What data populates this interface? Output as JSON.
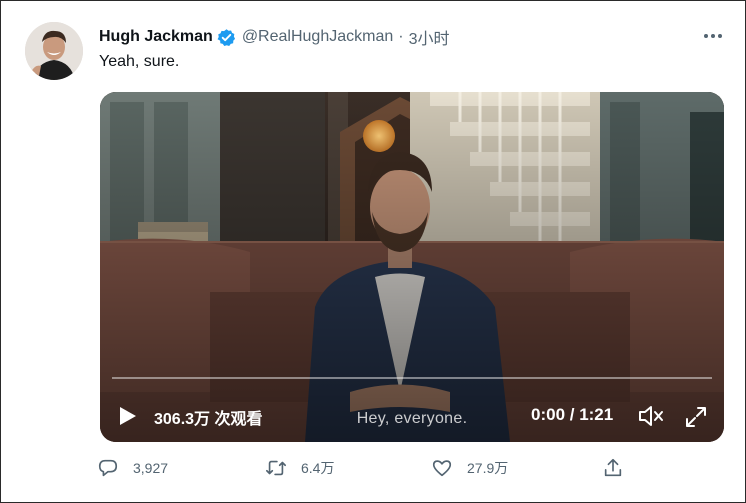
{
  "tweet": {
    "author_name": "Hugh Jackman",
    "handle": "@RealHughJackman",
    "separator": "·",
    "time": "3小时",
    "text": "Yeah, sure."
  },
  "video": {
    "views": "306.3万 次观看",
    "subtitle": "Hey, everyone.",
    "time": "0:00 / 1:21",
    "progress": 0.0
  },
  "actions": {
    "replies": "3,927",
    "retweets": "6.4万",
    "likes": "27.9万"
  },
  "colors": {
    "verified": "#1d9bf0",
    "muted_text": "#536471"
  },
  "icons": {
    "verified": "verified-badge-icon",
    "more": "more-icon",
    "play": "play-icon",
    "mute": "mute-icon",
    "expand": "expand-icon",
    "reply": "reply-icon",
    "retweet": "retweet-icon",
    "like": "like-icon",
    "share": "share-icon"
  }
}
